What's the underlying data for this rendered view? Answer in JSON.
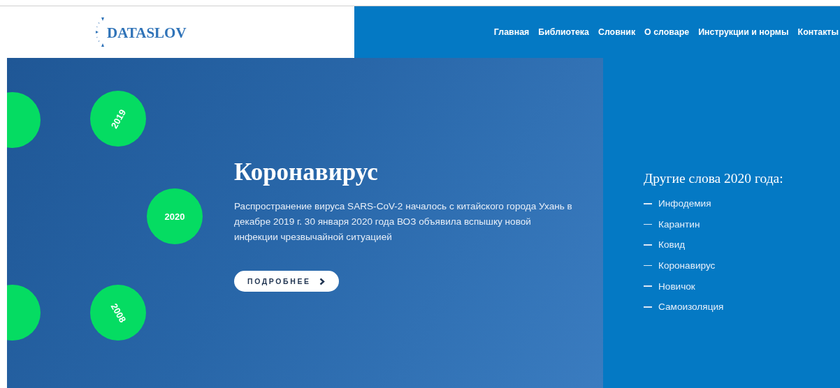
{
  "logo": {
    "text": "DATASLOV"
  },
  "nav": [
    "Главная",
    "Библиотека",
    "Словник",
    "О словаре",
    "Инструкции и нормы",
    "Контакты"
  ],
  "hero": {
    "year_badges": [
      {
        "label": "2019",
        "kind": "tilt-up"
      },
      {
        "label": "2020",
        "kind": "flat"
      },
      {
        "label": "2008",
        "kind": "tilt-down"
      }
    ],
    "title": "Коронавирус",
    "text": "Распространение вируса SARS-CoV-2 началось с китайского города Ухань в декабре 2019 г. 30 января 2020 года ВОЗ объявила вспышку новой инфекции чрезвычайной ситуацией",
    "button": "ПОДРОБНЕЕ"
  },
  "sidebar": {
    "heading": "Другие слова 2020 года:",
    "items": [
      "Инфодемия",
      "Карантин",
      "Ковид",
      "Коронавирус",
      "Новичок",
      "Самоизоляция"
    ]
  }
}
